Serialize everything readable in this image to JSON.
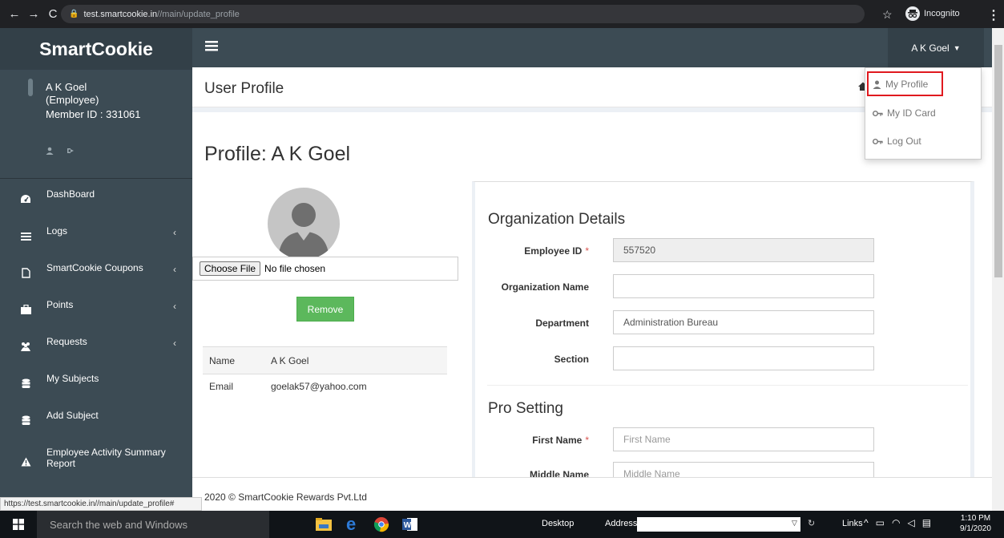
{
  "browser": {
    "url_host": "test.smartcookie.in",
    "url_path": "//main/update_profile",
    "incognito_label": "Incognito"
  },
  "sidebar": {
    "logo": "SmartCookie",
    "user_name": "A K Goel",
    "user_role": "(Employee)",
    "member_id": "Member ID : 331061",
    "items": [
      {
        "label": "DashBoard",
        "icon": "dashboard-icon",
        "has_children": false
      },
      {
        "label": "Logs",
        "icon": "list-icon",
        "has_children": true
      },
      {
        "label": "SmartCookie Coupons",
        "icon": "file-icon",
        "has_children": true
      },
      {
        "label": "Points",
        "icon": "briefcase-icon",
        "has_children": true
      },
      {
        "label": "Requests",
        "icon": "users-icon",
        "has_children": true
      },
      {
        "label": "My Subjects",
        "icon": "database-icon",
        "has_children": false
      },
      {
        "label": "Add Subject",
        "icon": "database-icon",
        "has_children": false
      },
      {
        "label": "Employee Activity Summary Report",
        "icon": "warning-icon",
        "has_children": false
      }
    ]
  },
  "topbar": {
    "user_menu_label": "A K Goel"
  },
  "dropdown": {
    "items": [
      {
        "label": "My Profile",
        "icon": "user-icon"
      },
      {
        "label": "My ID Card",
        "icon": "key-icon"
      },
      {
        "label": "Log Out",
        "icon": "key-icon"
      }
    ]
  },
  "page": {
    "title": "User Profile",
    "profile_title": "Profile: A K Goel",
    "choose_file_label": "Choose File",
    "no_file_label": "No file chosen",
    "remove_label": "Remove",
    "info": [
      {
        "key": "Name",
        "value": "A K Goel"
      },
      {
        "key": "Email",
        "value": "goelak57@yahoo.com"
      }
    ]
  },
  "org": {
    "section_title": "Organization Details",
    "fields": [
      {
        "label": "Employee ID",
        "required": true,
        "value": "557520",
        "readonly": true,
        "placeholder": ""
      },
      {
        "label": "Organization Name",
        "required": false,
        "value": "",
        "readonly": false,
        "placeholder": ""
      },
      {
        "label": "Department",
        "required": false,
        "value": "Administration Bureau",
        "readonly": false,
        "placeholder": ""
      },
      {
        "label": "Section",
        "required": false,
        "value": "",
        "readonly": false,
        "placeholder": ""
      }
    ]
  },
  "pro": {
    "section_title": "Pro Setting",
    "fields": [
      {
        "label": "First Name",
        "required": true,
        "value": "",
        "placeholder": "First Name"
      },
      {
        "label": "Middle Name",
        "required": false,
        "value": "",
        "placeholder": "Middle Name"
      }
    ]
  },
  "footer": {
    "text": "2020 © SmartCookie Rewards Pvt.Ltd"
  },
  "status_link": "https://test.smartcookie.in//main/update_profile#",
  "taskbar": {
    "search_placeholder": "Search the web and Windows",
    "desktop_label": "Desktop",
    "address_label": "Address",
    "links_label": "Links",
    "time": "1:10 PM",
    "date": "9/1/2020"
  },
  "colors": {
    "sidebar_bg": "#3c4b54",
    "logo_bg": "#334048",
    "remove_button": "#5cb85c",
    "highlight": "#e0191f",
    "required_star": "#d9534f"
  }
}
